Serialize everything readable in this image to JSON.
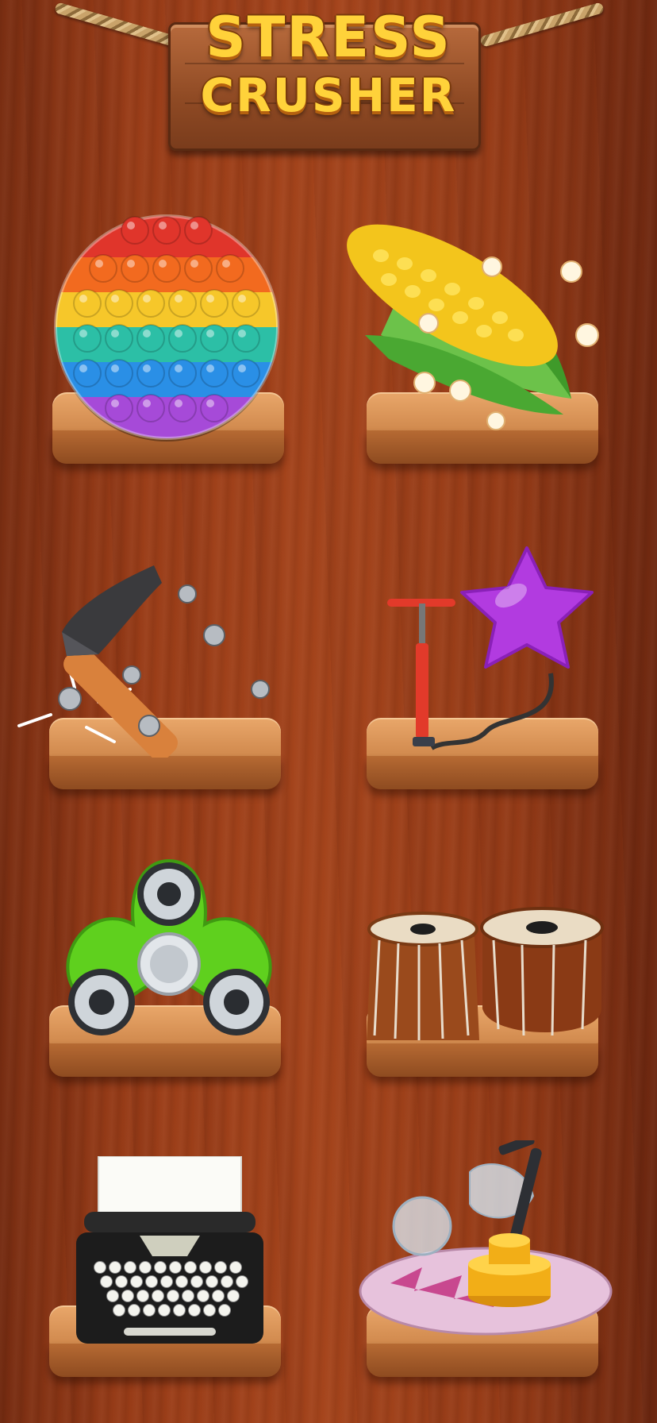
{
  "header": {
    "title_line1": "STRESS",
    "title_line2": "CRUSHER"
  },
  "games": [
    {
      "id": "pop-it"
    },
    {
      "id": "popcorn-corn"
    },
    {
      "id": "hammer-nails"
    },
    {
      "id": "balloon-pump"
    },
    {
      "id": "fidget-spinner"
    },
    {
      "id": "tabla-drums"
    },
    {
      "id": "typewriter"
    },
    {
      "id": "slime-grinder"
    }
  ],
  "colors": {
    "title_yellow": "#ffd23a",
    "wood_background": "#a6451c",
    "shelf_top": "#e9a76a",
    "spinner_green": "#5fd01e",
    "balloon_purple": "#b23be0"
  },
  "popit_rows": [
    "#e0352b",
    "#f26a1f",
    "#f6c72a",
    "#2cbfa6",
    "#2a8fe6",
    "#a64ad8"
  ]
}
